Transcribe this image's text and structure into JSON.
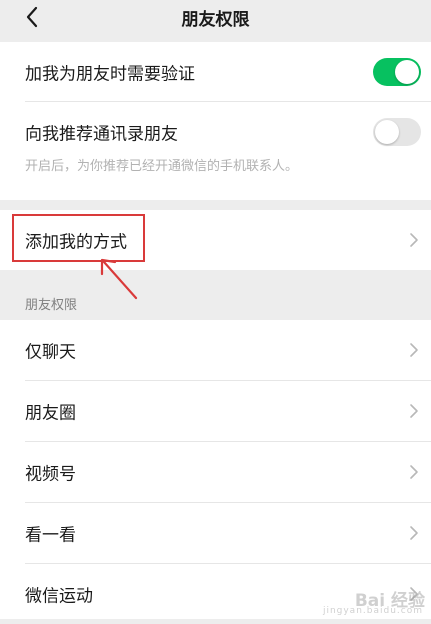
{
  "header": {
    "title": "朋友权限"
  },
  "verification": {
    "label": "加我为朋友时需要验证",
    "enabled": true
  },
  "recommend_contacts": {
    "label": "向我推荐通讯录朋友",
    "enabled": false,
    "hint": "开启后，为你推荐已经开通微信的手机联系人。"
  },
  "add_methods": {
    "label": "添加我的方式"
  },
  "friend_permissions": {
    "section_title": "朋友权限",
    "items": [
      {
        "label": "仅聊天"
      },
      {
        "label": "朋友圈"
      },
      {
        "label": "视频号"
      },
      {
        "label": "看一看"
      },
      {
        "label": "微信运动"
      }
    ]
  },
  "colors": {
    "toggle_on": "#07c160",
    "toggle_off": "#e5e5e5",
    "annotation_red": "#d93a3a",
    "background": "#ededed"
  },
  "icons": [
    "back-arrow-icon",
    "chevron-right-icon"
  ],
  "watermark": {
    "brand": "Bai 经验",
    "sub": "jingyan.baidu.com"
  }
}
